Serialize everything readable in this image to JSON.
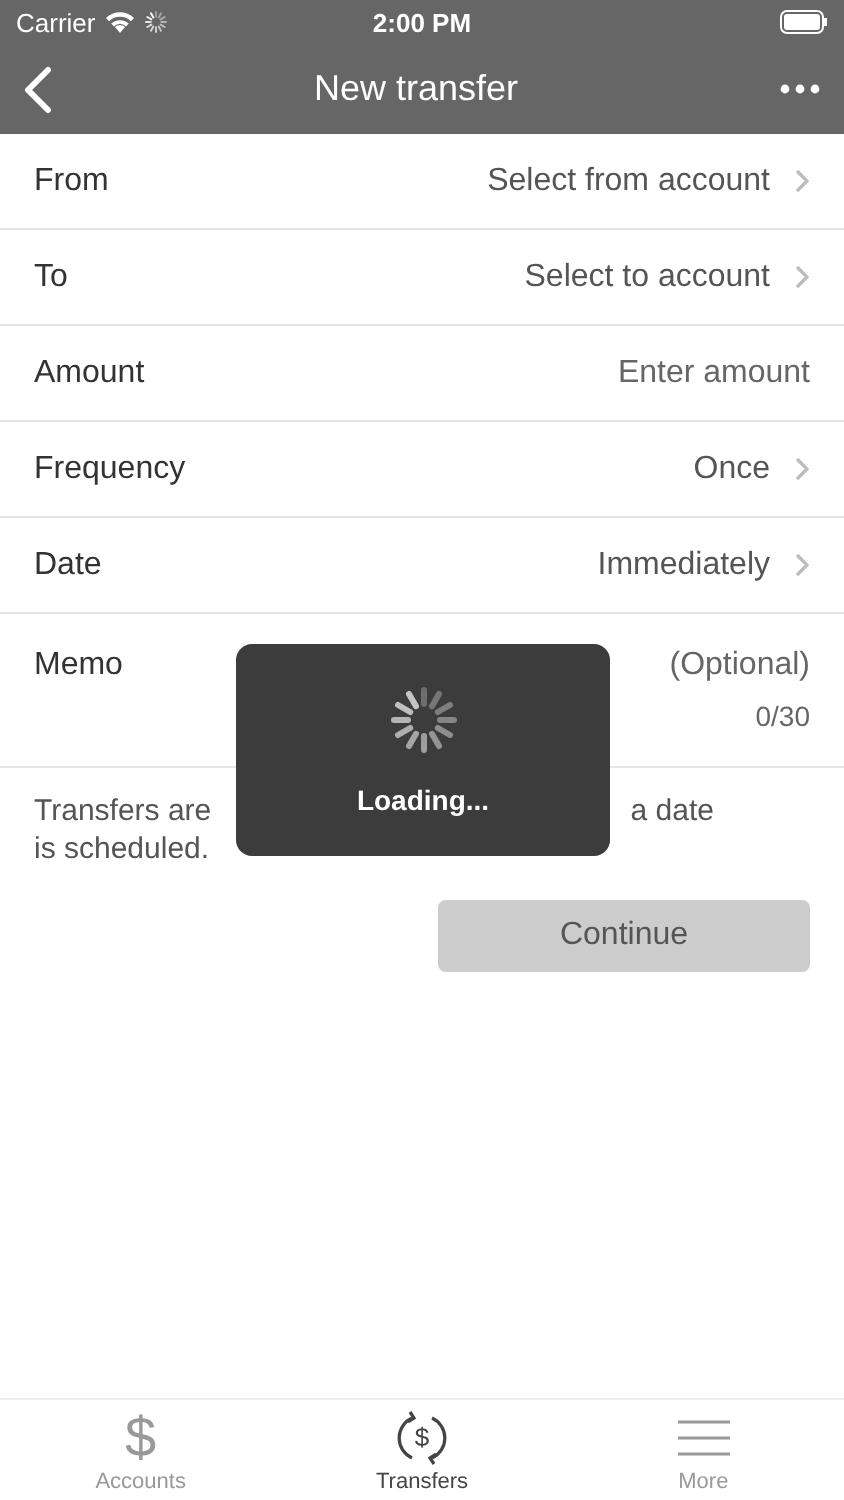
{
  "status_bar": {
    "carrier": "Carrier",
    "time": "2:00 PM"
  },
  "nav": {
    "title": "New transfer"
  },
  "rows": [
    {
      "kind": "select",
      "label": "From",
      "value": "Select from account"
    },
    {
      "kind": "select",
      "label": "To",
      "value": "Select to account"
    },
    {
      "kind": "input",
      "label": "Amount",
      "placeholder": "Enter amount"
    },
    {
      "kind": "select",
      "label": "Frequency",
      "value": "Once"
    },
    {
      "kind": "select",
      "label": "Date",
      "value": "Immediately"
    },
    {
      "kind": "memo",
      "label": "Memo",
      "placeholder": "(Optional)",
      "counter": "0/30"
    }
  ],
  "note": {
    "line_1_start": "Transfers are",
    "line_1_end": "a date",
    "line_2": "is scheduled."
  },
  "continue_button": {
    "label": "Continue",
    "disabled": true
  },
  "loading": {
    "label": "Loading..."
  },
  "tab_bar": [
    {
      "kind": "dollar",
      "label": "Accounts",
      "icon_text": "$",
      "selected": false
    },
    {
      "kind": "transfer",
      "label": "Transfers",
      "icon_text": "$",
      "selected": true
    },
    {
      "kind": "menu",
      "label": "More",
      "selected": false
    }
  ]
}
